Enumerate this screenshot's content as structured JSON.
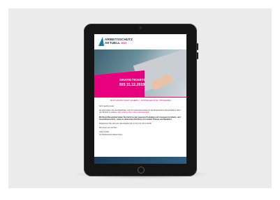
{
  "email": {
    "logo": {
      "line1": "ARBEITSSCHUTZ",
      "line2": "AKTUELL",
      "year": "2019"
    },
    "hero": {
      "tickets_label": "GRATIS-TICKETS",
      "date_label": "BIS 31.12.2019!"
    },
    "nav_links": [
      "JETZT GRATIS-TICKET SICHERN",
      "AUSSTELLERLISTE",
      "PROGRAMM"
    ],
    "greeting": "Sehr geehrte Leser,",
    "para1": "ab sofort haben Sie die Möglichkeit, sich Ihr Gratis-Messeticket für die Arbeitsschutz Aktuell 2020 im Wert von 36,00 € zu sichern.",
    "para1_link": "Wie, erfahren Sie in Ihrer Fachzeitschrift.",
    "para2": "Mit Ihrem Messeticket haben Sie Zutritt zu den neuesten Produkten und Lösungen im Arbeits- und Gesundheitsschutz, sowie zu zahlreichen Fachforen mit starken Themen und Speakern.",
    "para3": "Registrieren Sie sich jetzt, das Angebot gilt nur bis zum 31.12.2019!",
    "closing": "Wir freuen uns auf Sie!",
    "signoff1": "Liebe Grüße,",
    "signoff2": "Ihr Arbeitsschutz Aktuell Team"
  },
  "colors": {
    "accent": "#e6007e",
    "brand": "#1b7f9a",
    "bezel": "#151515"
  }
}
